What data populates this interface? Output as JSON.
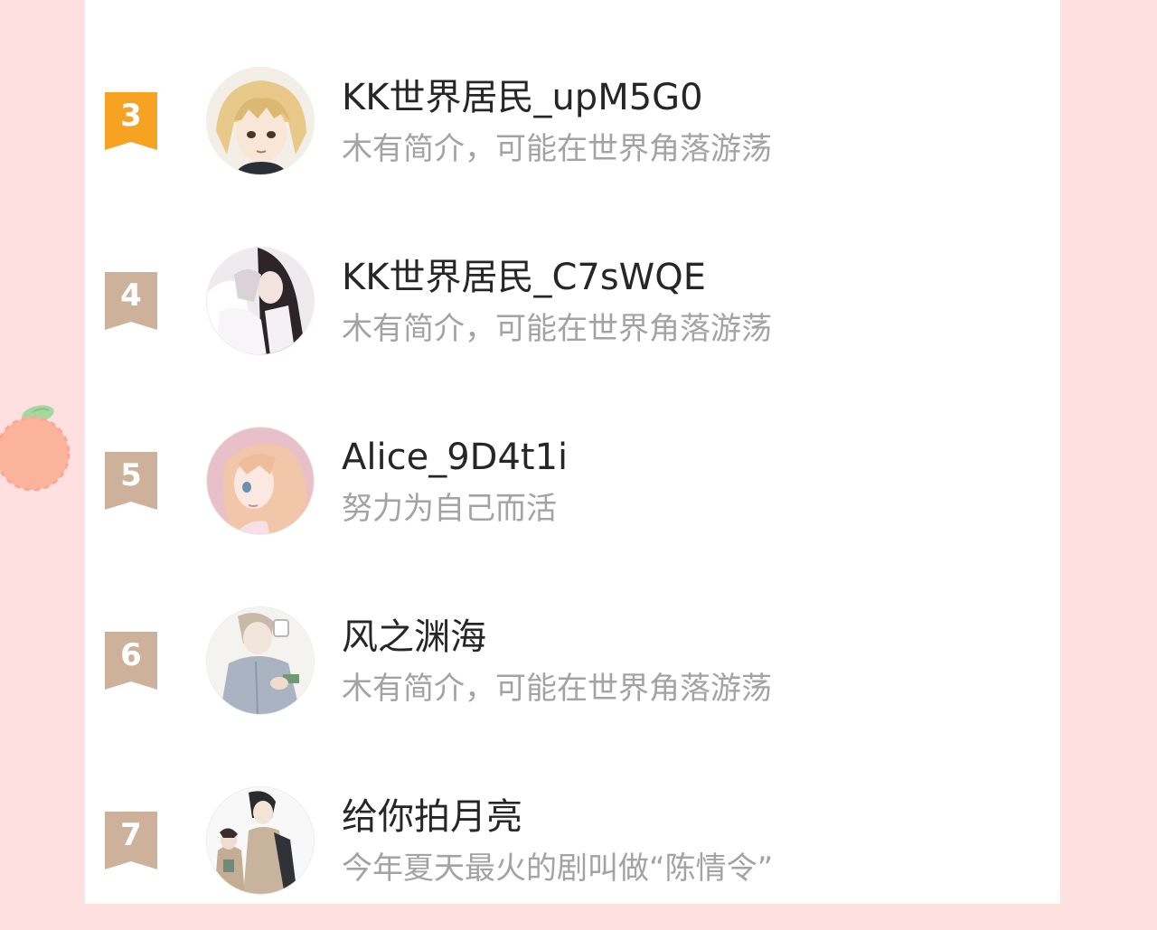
{
  "colors": {
    "page_background": "#fde0df",
    "panel_background": "#ffffff",
    "rank_top3_badge": "#f6a323",
    "rank_other_badge": "#cdb19a",
    "name_text": "#262626",
    "bio_text": "#a3a3a3"
  },
  "decoration": {
    "icon": "peach-icon"
  },
  "ranking": {
    "users": [
      {
        "rank": "3",
        "name": "KK世界居民_upM5G0",
        "bio": "木有简介，可能在世界角落游荡",
        "badge_color": "#f6a323",
        "avatar_icon": "blonde-anime-boy-avatar"
      },
      {
        "rank": "4",
        "name": "KK世界居民_C7sWQE",
        "bio": "木有简介，可能在世界角落游荡",
        "badge_color": "#cdb19a",
        "avatar_icon": "anime-couple-white-robes-avatar"
      },
      {
        "rank": "5",
        "name": "Alice_9D4t1i",
        "bio": "努力为自己而活",
        "badge_color": "#cdb19a",
        "avatar_icon": "pink-haired-anime-girl-avatar"
      },
      {
        "rank": "6",
        "name": "风之渊海",
        "bio": "木有简介，可能在世界角落游荡",
        "badge_color": "#cdb19a",
        "avatar_icon": "sketch-man-drinking-avatar"
      },
      {
        "rank": "7",
        "name": "给你拍月亮",
        "bio": "今年夏天最火的剧叫做“陈情令”",
        "badge_color": "#cdb19a",
        "avatar_icon": "boy-and-girl-jackets-avatar"
      }
    ]
  }
}
